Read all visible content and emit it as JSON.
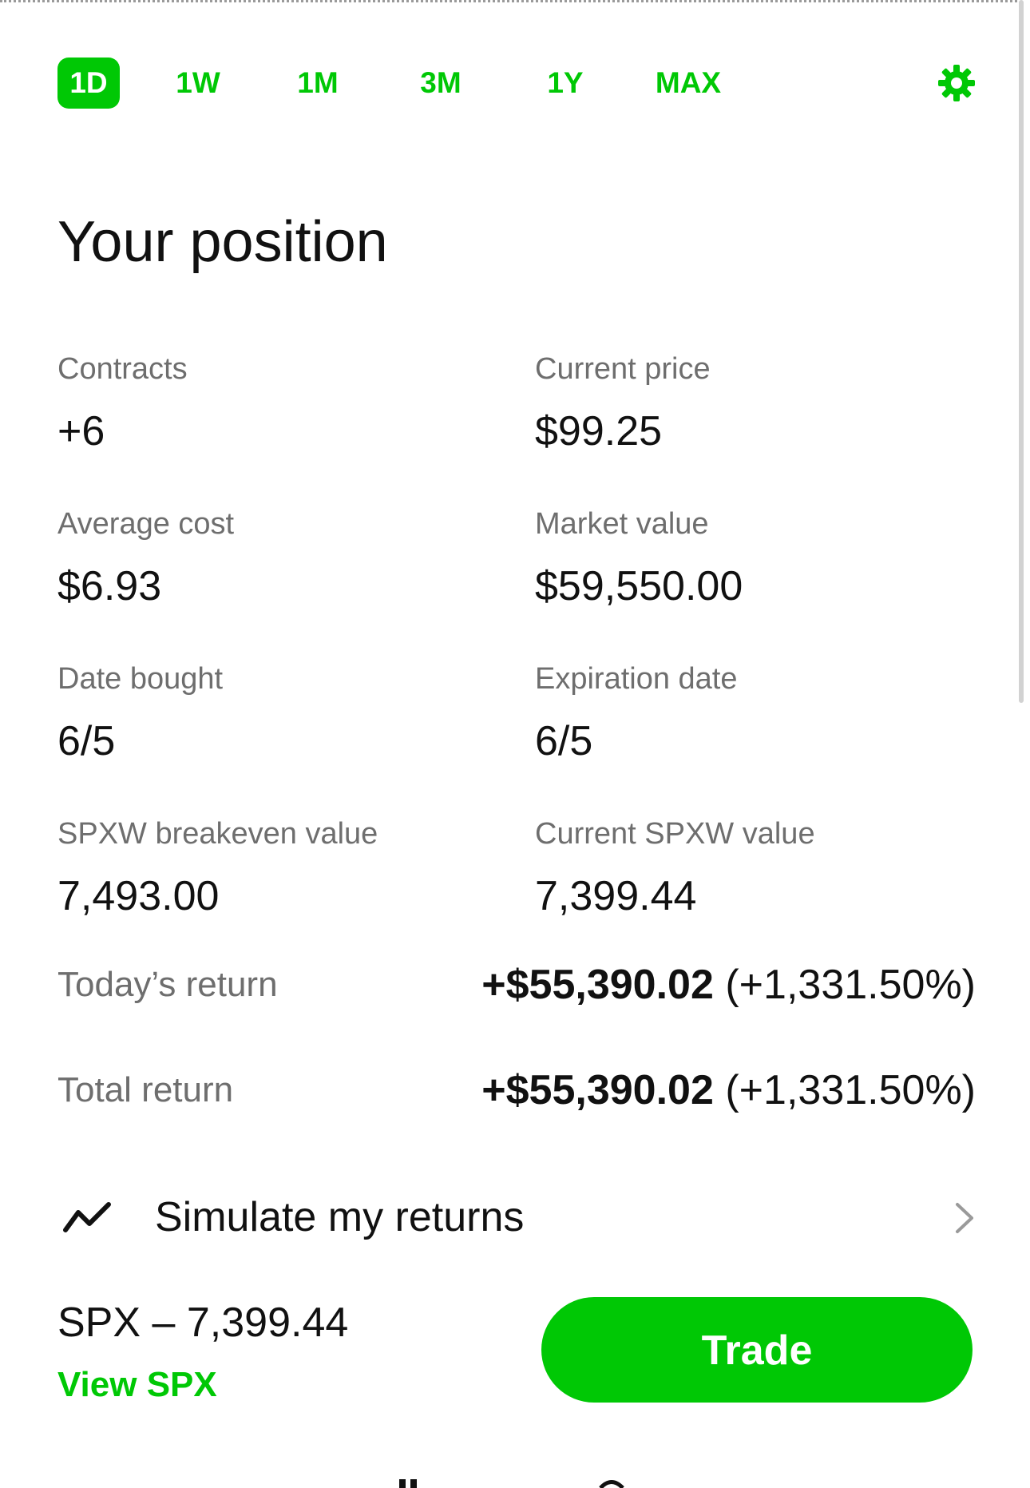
{
  "range_tabs": [
    {
      "label": "1D",
      "active": true
    },
    {
      "label": "1W",
      "active": false
    },
    {
      "label": "1M",
      "active": false
    },
    {
      "label": "3M",
      "active": false
    },
    {
      "label": "1Y",
      "active": false
    },
    {
      "label": "MAX",
      "active": false
    }
  ],
  "settings": {
    "icon": "gear-icon"
  },
  "position": {
    "title": "Your position",
    "stats": [
      {
        "label": "Contracts",
        "value": "+6"
      },
      {
        "label": "Current price",
        "value": "$99.25"
      },
      {
        "label": "Average cost",
        "value": "$6.93"
      },
      {
        "label": "Market value",
        "value": "$59,550.00"
      },
      {
        "label": "Date bought",
        "value": "6/5"
      },
      {
        "label": "Expiration date",
        "value": "6/5"
      },
      {
        "label": "SPXW breakeven value",
        "value": "7,493.00"
      },
      {
        "label": "Current SPXW value",
        "value": "7,399.44"
      }
    ],
    "todays_return": {
      "label": "Today’s return",
      "amount": "+$55,390.02",
      "percent": "(+1,331.50%)"
    },
    "total_return": {
      "label": "Total return",
      "amount": "+$55,390.02",
      "percent": "(+1,331.50%)"
    }
  },
  "simulate": {
    "label": "Simulate my returns",
    "icon": "trend-line-icon"
  },
  "underlying": {
    "text": "SPX – 7,399.44",
    "link": "View SPX"
  },
  "trade_button": {
    "label": "Trade"
  },
  "colors": {
    "accent": "#00c805",
    "text": "#111111",
    "muted": "#6e6e6e"
  }
}
